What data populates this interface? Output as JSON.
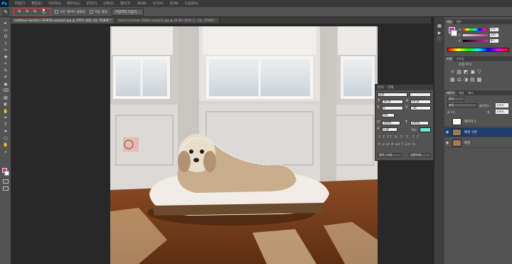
{
  "app": {
    "logo": "Ps"
  },
  "menu": [
    "파일(F)",
    "편집(E)",
    "이미지(I)",
    "레이어(L)",
    "문자(Y)",
    "선택(S)",
    "필터(T)",
    "3D(D)",
    "보기(V)",
    "창(W)",
    "도움말(H)"
  ],
  "options": {
    "brush_size": "30",
    "sample_all_layers_label": "모든 레이어 샘플링",
    "auto_enhance_label": "자동 향상",
    "refine_edge_label": "가장자리 다듬기..."
  },
  "doc_tabs": [
    {
      "label": "matthew-hamilton-292858-unsplash.jpg @ 100% (배경 사본, RGB/8) *",
      "active": true
    },
    {
      "label": "david-scrivener-3184h-unsplash.jpg @ 29.8% (레이어 2, 사본, RGB/8) *",
      "active": false
    }
  ],
  "toolbar": {
    "tools": [
      "▸",
      "▭",
      "ʘ",
      "⌇",
      "✂",
      "✚",
      "⌖",
      "✎",
      "✐",
      "◉",
      "⌫",
      "▤",
      "◐",
      "✋",
      "✒",
      "T",
      "➤",
      "▢",
      "✋",
      "⌕"
    ]
  },
  "character_panel": {
    "tabs": [
      "문자",
      "단락"
    ],
    "font_family": "굴림",
    "font_style": "-",
    "font_size": "30 pt",
    "leading": "50 pt",
    "kerning": "0",
    "tracking": "-30",
    "tsume": "0%",
    "vertical_scale": "100%",
    "horizontal_scale": "100%",
    "baseline_shift": "0 pt",
    "color_label": "색상:",
    "text_color": "#6fe6d8",
    "glyph_row": "T T TT Tr T' T, T T",
    "glyph_row2": "fi σ st A ad T 1st ½",
    "language": "영어 : 미국",
    "antialias": "선명하게"
  },
  "color_panel": {
    "tabs": [
      "색상",
      "견본"
    ],
    "h_label": "H",
    "s_label": "S",
    "b_label": "B",
    "h_value": "315",
    "s_value": "100",
    "b_value": "85"
  },
  "adjust_panel": {
    "tabs": [
      "조정",
      "스타일"
    ],
    "title": "조정 추가"
  },
  "layers_panel": {
    "tabs": [
      "레이어",
      "채널",
      "패스"
    ],
    "kind": "종류",
    "blend_mode": "표준",
    "opacity_label": "불투명도:",
    "opacity": "100%",
    "lock_label": "잠그기:",
    "fill_label": "칠:",
    "fill": "100%",
    "layers": [
      {
        "name": "레이어 1",
        "selected": false
      },
      {
        "name": "배경 사본",
        "selected": true
      },
      {
        "name": "배경",
        "selected": false
      }
    ]
  },
  "colors": {
    "foreground": "#d42fb0",
    "accent_red": "#e03a35"
  }
}
